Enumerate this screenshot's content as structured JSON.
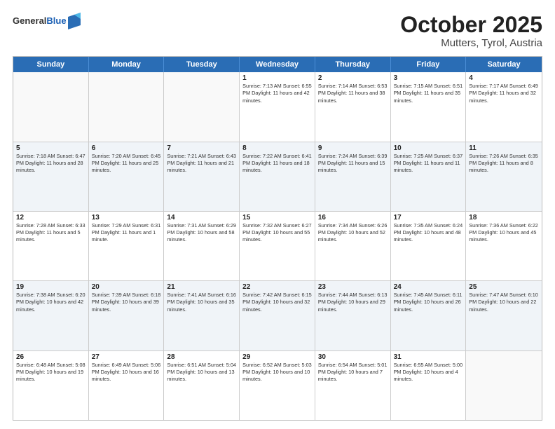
{
  "header": {
    "logo_line1": "General",
    "logo_line2": "Blue",
    "title": "October 2025",
    "subtitle": "Mutters, Tyrol, Austria"
  },
  "weekdays": [
    "Sunday",
    "Monday",
    "Tuesday",
    "Wednesday",
    "Thursday",
    "Friday",
    "Saturday"
  ],
  "rows": [
    {
      "alt": false,
      "cells": [
        {
          "day": "",
          "text": ""
        },
        {
          "day": "",
          "text": ""
        },
        {
          "day": "",
          "text": ""
        },
        {
          "day": "1",
          "text": "Sunrise: 7:13 AM\nSunset: 6:55 PM\nDaylight: 11 hours and 42 minutes."
        },
        {
          "day": "2",
          "text": "Sunrise: 7:14 AM\nSunset: 6:53 PM\nDaylight: 11 hours and 38 minutes."
        },
        {
          "day": "3",
          "text": "Sunrise: 7:15 AM\nSunset: 6:51 PM\nDaylight: 11 hours and 35 minutes."
        },
        {
          "day": "4",
          "text": "Sunrise: 7:17 AM\nSunset: 6:49 PM\nDaylight: 11 hours and 32 minutes."
        }
      ]
    },
    {
      "alt": true,
      "cells": [
        {
          "day": "5",
          "text": "Sunrise: 7:18 AM\nSunset: 6:47 PM\nDaylight: 11 hours and 28 minutes."
        },
        {
          "day": "6",
          "text": "Sunrise: 7:20 AM\nSunset: 6:45 PM\nDaylight: 11 hours and 25 minutes."
        },
        {
          "day": "7",
          "text": "Sunrise: 7:21 AM\nSunset: 6:43 PM\nDaylight: 11 hours and 21 minutes."
        },
        {
          "day": "8",
          "text": "Sunrise: 7:22 AM\nSunset: 6:41 PM\nDaylight: 11 hours and 18 minutes."
        },
        {
          "day": "9",
          "text": "Sunrise: 7:24 AM\nSunset: 6:39 PM\nDaylight: 11 hours and 15 minutes."
        },
        {
          "day": "10",
          "text": "Sunrise: 7:25 AM\nSunset: 6:37 PM\nDaylight: 11 hours and 11 minutes."
        },
        {
          "day": "11",
          "text": "Sunrise: 7:26 AM\nSunset: 6:35 PM\nDaylight: 11 hours and 8 minutes."
        }
      ]
    },
    {
      "alt": false,
      "cells": [
        {
          "day": "12",
          "text": "Sunrise: 7:28 AM\nSunset: 6:33 PM\nDaylight: 11 hours and 5 minutes."
        },
        {
          "day": "13",
          "text": "Sunrise: 7:29 AM\nSunset: 6:31 PM\nDaylight: 11 hours and 1 minute."
        },
        {
          "day": "14",
          "text": "Sunrise: 7:31 AM\nSunset: 6:29 PM\nDaylight: 10 hours and 58 minutes."
        },
        {
          "day": "15",
          "text": "Sunrise: 7:32 AM\nSunset: 6:27 PM\nDaylight: 10 hours and 55 minutes."
        },
        {
          "day": "16",
          "text": "Sunrise: 7:34 AM\nSunset: 6:26 PM\nDaylight: 10 hours and 52 minutes."
        },
        {
          "day": "17",
          "text": "Sunrise: 7:35 AM\nSunset: 6:24 PM\nDaylight: 10 hours and 48 minutes."
        },
        {
          "day": "18",
          "text": "Sunrise: 7:36 AM\nSunset: 6:22 PM\nDaylight: 10 hours and 45 minutes."
        }
      ]
    },
    {
      "alt": true,
      "cells": [
        {
          "day": "19",
          "text": "Sunrise: 7:38 AM\nSunset: 6:20 PM\nDaylight: 10 hours and 42 minutes."
        },
        {
          "day": "20",
          "text": "Sunrise: 7:39 AM\nSunset: 6:18 PM\nDaylight: 10 hours and 39 minutes."
        },
        {
          "day": "21",
          "text": "Sunrise: 7:41 AM\nSunset: 6:16 PM\nDaylight: 10 hours and 35 minutes."
        },
        {
          "day": "22",
          "text": "Sunrise: 7:42 AM\nSunset: 6:15 PM\nDaylight: 10 hours and 32 minutes."
        },
        {
          "day": "23",
          "text": "Sunrise: 7:44 AM\nSunset: 6:13 PM\nDaylight: 10 hours and 29 minutes."
        },
        {
          "day": "24",
          "text": "Sunrise: 7:45 AM\nSunset: 6:11 PM\nDaylight: 10 hours and 26 minutes."
        },
        {
          "day": "25",
          "text": "Sunrise: 7:47 AM\nSunset: 6:10 PM\nDaylight: 10 hours and 22 minutes."
        }
      ]
    },
    {
      "alt": false,
      "cells": [
        {
          "day": "26",
          "text": "Sunrise: 6:48 AM\nSunset: 5:08 PM\nDaylight: 10 hours and 19 minutes."
        },
        {
          "day": "27",
          "text": "Sunrise: 6:49 AM\nSunset: 5:06 PM\nDaylight: 10 hours and 16 minutes."
        },
        {
          "day": "28",
          "text": "Sunrise: 6:51 AM\nSunset: 5:04 PM\nDaylight: 10 hours and 13 minutes."
        },
        {
          "day": "29",
          "text": "Sunrise: 6:52 AM\nSunset: 5:03 PM\nDaylight: 10 hours and 10 minutes."
        },
        {
          "day": "30",
          "text": "Sunrise: 6:54 AM\nSunset: 5:01 PM\nDaylight: 10 hours and 7 minutes."
        },
        {
          "day": "31",
          "text": "Sunrise: 6:55 AM\nSunset: 5:00 PM\nDaylight: 10 hours and 4 minutes."
        },
        {
          "day": "",
          "text": ""
        }
      ]
    }
  ]
}
